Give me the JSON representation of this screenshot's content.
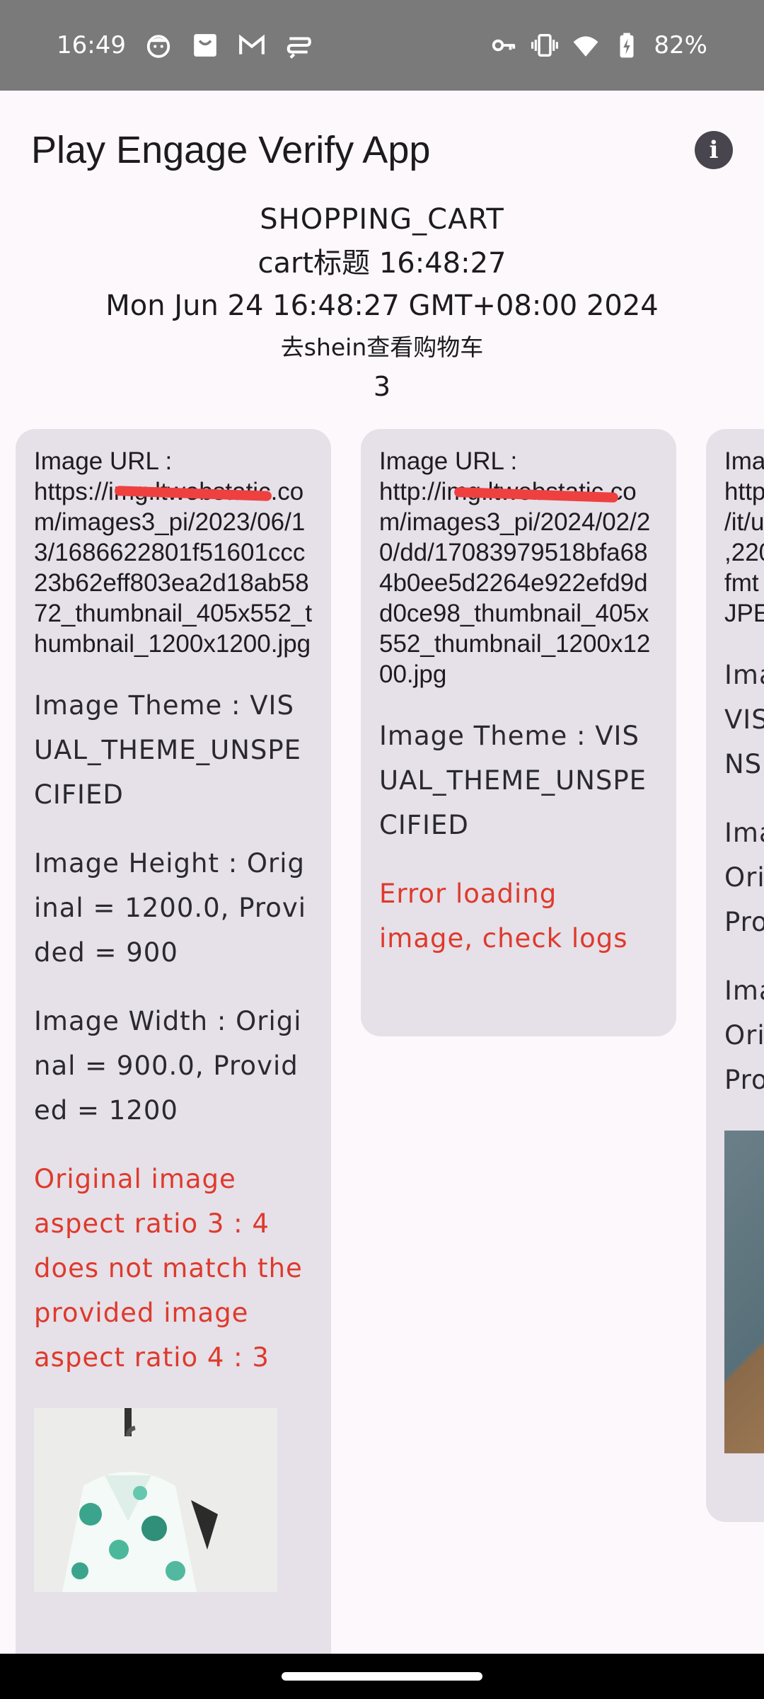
{
  "status_bar": {
    "time": "16:49",
    "battery": "82%",
    "left_icons": [
      "smiley-notification-icon",
      "shopping-bag-notification-icon",
      "gmail-icon",
      "messages-notification-icon"
    ],
    "right_icons": [
      "vpn-key-icon",
      "vibrate-icon",
      "wifi-icon",
      "battery-charging-icon"
    ]
  },
  "app_bar": {
    "title": "Play Engage Verify App",
    "info_icon": "info-icon"
  },
  "header": {
    "type": "SHOPPING_CART",
    "title": "cart标题 16:48:27",
    "date": "Mon Jun 24 16:48:27 GMT+08:00 2024",
    "action": "去shein查看购物车",
    "count": "3"
  },
  "cards": [
    {
      "url_label": "Image URL :",
      "url_value": "https://img.ltwebstatic.com/images3_pi/2023/06/13/1686622801f51601ccc23b62eff803ea2d18ab5872_thumbnail_405x552_thumbnail_1200x1200.jpg",
      "theme": "Image Theme : VISUAL_THEME_UNSPECIFIED",
      "height": "Image Height : Original = 1200.0, Provided = 900",
      "width": "Image Width : Original = 900.0, Provided = 1200",
      "error": "Original image aspect ratio 3 : 4 does not match the provided image aspect ratio 4 : 3"
    },
    {
      "url_label": "Image URL :",
      "url_value": "http://img.ltwebstatic.com/images3_pi/2024/02/20/dd/17083979518bfa684b0ee5d2264e922efd9dd0ce98_thumbnail_405x552_thumbnail_1200x1200.jpg",
      "theme": "Image Theme : VISUAL_THEME_UNSPECIFIED",
      "error": "Error loading image, check logs"
    },
    {
      "url_label": "Ima",
      "url_lines": [
        "http",
        "/it/u",
        ",220",
        "fmt",
        "JPE"
      ],
      "theme_lines": [
        "Ima",
        "VIS",
        "NS"
      ],
      "height_lines": [
        "Ima",
        "Ori",
        "Pro"
      ],
      "width_lines": [
        "Ima",
        "Ori",
        "Pro"
      ]
    }
  ]
}
